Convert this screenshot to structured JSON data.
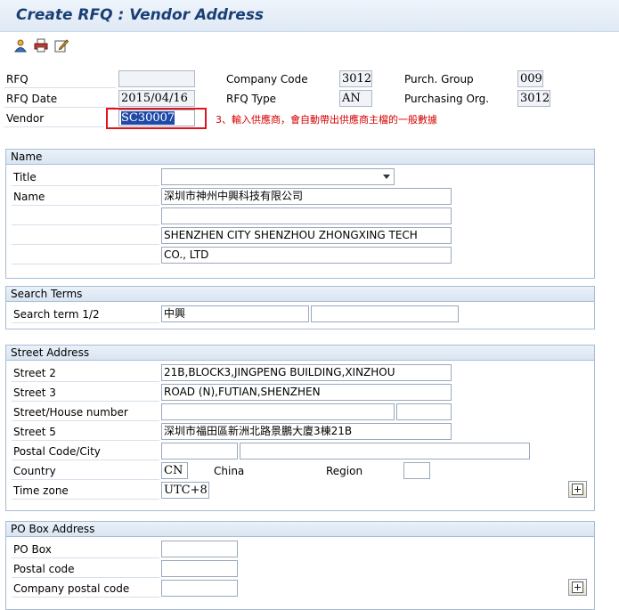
{
  "window": {
    "title": "Create RFQ : Vendor Address"
  },
  "toolbar": {
    "icons": [
      "person-icon",
      "print-icon",
      "edit-icon"
    ]
  },
  "header": {
    "rfq_label": "RFQ",
    "rfq_value": "",
    "rfq_date_label": "RFQ Date",
    "rfq_date_value": "2015/04/16",
    "vendor_label": "Vendor",
    "vendor_value": "SC30007",
    "company_code_label": "Company Code",
    "company_code_value": "3012",
    "rfq_type_label": "RFQ Type",
    "rfq_type_value": "AN",
    "purch_group_label": "Purch. Group",
    "purch_group_value": "009",
    "purch_org_label": "Purchasing Org.",
    "purch_org_value": "3012",
    "note": "3、輸入供應商，會自動帶出供應商主檔的一般數據"
  },
  "name_group": {
    "heading": "Name",
    "title_label": "Title",
    "title_value": "",
    "name_label": "Name",
    "name1": "深圳市神州中興科技有限公司",
    "name2": "",
    "name3": "SHENZHEN CITY SHENZHOU ZHONGXING TECH",
    "name4": "CO., LTD"
  },
  "search_group": {
    "heading": "Search Terms",
    "label": "Search term 1/2",
    "term1": "中興",
    "term2": ""
  },
  "street_group": {
    "heading": "Street Address",
    "street2_label": "Street 2",
    "street2_value": "21B,BLOCK3,JINGPENG BUILDING,XINZHOU",
    "street3_label": "Street 3",
    "street3_value": "ROAD (N),FUTIAN,SHENZHEN",
    "house_label": "Street/House number",
    "street_value": "",
    "house_value": "",
    "street5_label": "Street 5",
    "street5_value": "深圳市福田區新洲北路景鵬大廈3棟21B",
    "postal_label": "Postal Code/City",
    "postal_value": "",
    "city_value": "",
    "country_label": "Country",
    "country_value": "CN",
    "country_name": "China",
    "region_label": "Region",
    "region_value": "",
    "tz_label": "Time zone",
    "tz_value": "UTC+8"
  },
  "po_group": {
    "heading": "PO Box Address",
    "pobox_label": "PO Box",
    "pobox_value": "",
    "postal_label": "Postal code",
    "postal_value": "",
    "company_postal_label": "Company postal code",
    "company_postal_value": ""
  }
}
